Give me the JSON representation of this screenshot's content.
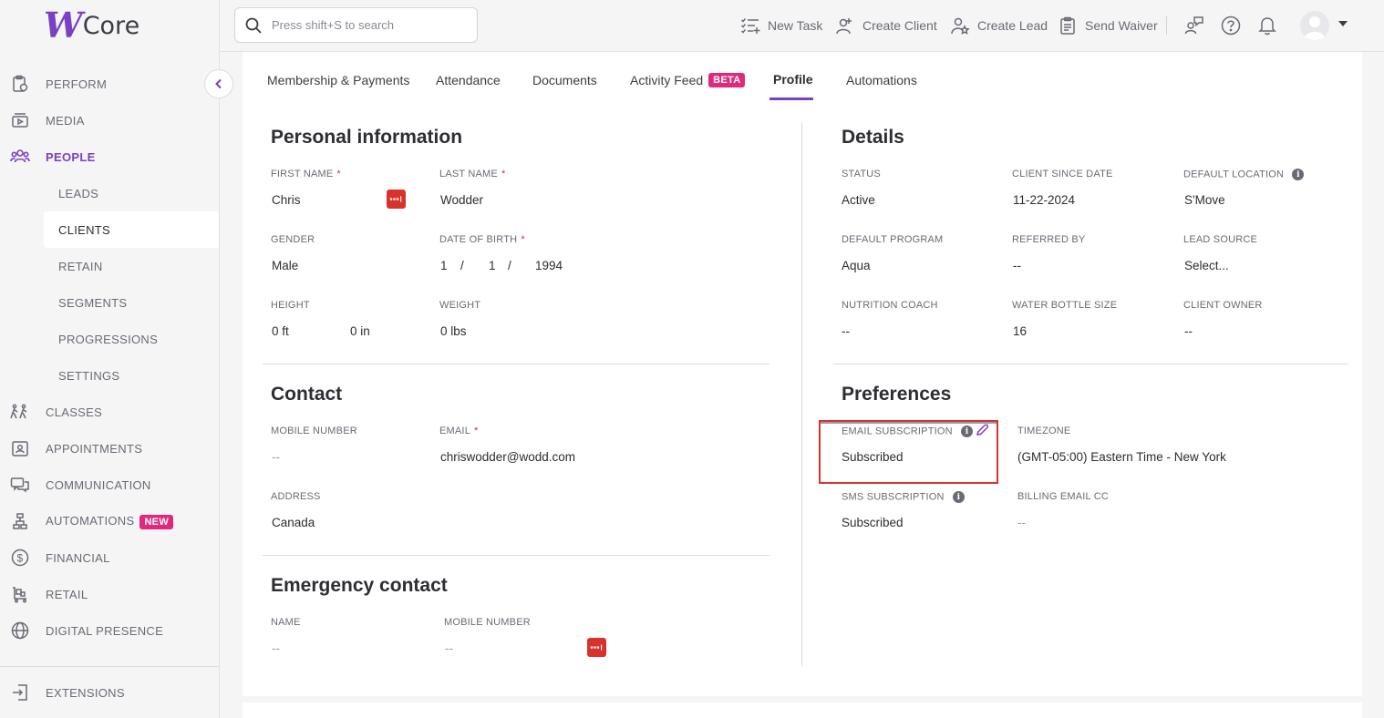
{
  "app": {
    "logo_mark": "W",
    "logo_text": "Core"
  },
  "sidebar": {
    "items": [
      {
        "label": "PERFORM",
        "icon": "clipboard-icon"
      },
      {
        "label": "MEDIA",
        "icon": "media-icon"
      },
      {
        "label": "PEOPLE",
        "icon": "people-icon"
      },
      {
        "label": "CLASSES",
        "icon": "classes-icon"
      },
      {
        "label": "APPOINTMENTS",
        "icon": "appointments-icon"
      },
      {
        "label": "COMMUNICATION",
        "icon": "chat-icon"
      },
      {
        "label": "AUTOMATIONS",
        "icon": "automations-icon",
        "badge": "NEW"
      },
      {
        "label": "FINANCIAL",
        "icon": "dollar-icon"
      },
      {
        "label": "RETAIL",
        "icon": "retail-icon"
      },
      {
        "label": "DIGITAL PRESENCE",
        "icon": "globe-icon"
      },
      {
        "label": "EXTENSIONS",
        "icon": "extensions-icon"
      }
    ],
    "people_sub": [
      "LEADS",
      "CLIENTS",
      "RETAIN",
      "SEGMENTS",
      "PROGRESSIONS",
      "SETTINGS"
    ]
  },
  "topbar": {
    "search_placeholder": "Press shift+S to search",
    "actions": [
      "New Task",
      "Create Client",
      "Create Lead",
      "Send Waiver"
    ]
  },
  "tabs": [
    {
      "label": "Membership & Payments"
    },
    {
      "label": "Attendance"
    },
    {
      "label": "Documents"
    },
    {
      "label": "Activity Feed",
      "badge": "BETA"
    },
    {
      "label": "Profile"
    },
    {
      "label": "Automations"
    }
  ],
  "personal": {
    "title": "Personal information",
    "first_name_label": "FIRST NAME",
    "first_name": "Chris",
    "last_name_label": "LAST NAME",
    "last_name": "Wodder",
    "gender_label": "GENDER",
    "gender": "Male",
    "dob_label": "DATE OF BIRTH",
    "dob_month": "1",
    "dob_sep": "/",
    "dob_day": "1",
    "dob_year": "1994",
    "height_label": "HEIGHT",
    "height_ft": "0 ft",
    "height_in": "0 in",
    "weight_label": "WEIGHT",
    "weight": "0 lbs",
    "required_mark": "*"
  },
  "contact": {
    "title": "Contact",
    "mobile_label": "MOBILE NUMBER",
    "mobile": "--",
    "email_label": "EMAIL",
    "email": "chriswodder@wodd.com",
    "address_label": "ADDRESS",
    "address": "Canada"
  },
  "emergency": {
    "title": "Emergency contact",
    "name_label": "NAME",
    "name": "--",
    "mobile_label": "MOBILE NUMBER",
    "mobile": "--"
  },
  "details": {
    "title": "Details",
    "status_label": "STATUS",
    "status": "Active",
    "client_since_label": "CLIENT SINCE DATE",
    "client_since": "11-22-2024",
    "default_location_label": "DEFAULT LOCATION",
    "default_location": "S'Move",
    "default_program_label": "DEFAULT PROGRAM",
    "default_program": "Aqua",
    "referred_by_label": "REFERRED BY",
    "referred_by": "--",
    "lead_source_label": "LEAD SOURCE",
    "lead_source": "Select...",
    "nutrition_coach_label": "NUTRITION COACH",
    "nutrition_coach": "--",
    "water_bottle_label": "WATER BOTTLE SIZE",
    "water_bottle": "16",
    "client_owner_label": "CLIENT OWNER",
    "client_owner": "--"
  },
  "preferences": {
    "title": "Preferences",
    "email_sub_label": "EMAIL SUBSCRIPTION",
    "email_sub": "Subscribed",
    "timezone_label": "TIMEZONE",
    "timezone": "(GMT-05:00) Eastern Time - New York",
    "sms_sub_label": "SMS SUBSCRIPTION",
    "sms_sub": "Subscribed",
    "billing_cc_label": "BILLING EMAIL CC",
    "billing_cc": "--"
  },
  "colors": {
    "accent": "#7b3fc4",
    "badge": "#e0287c",
    "highlight": "#d9322b"
  }
}
